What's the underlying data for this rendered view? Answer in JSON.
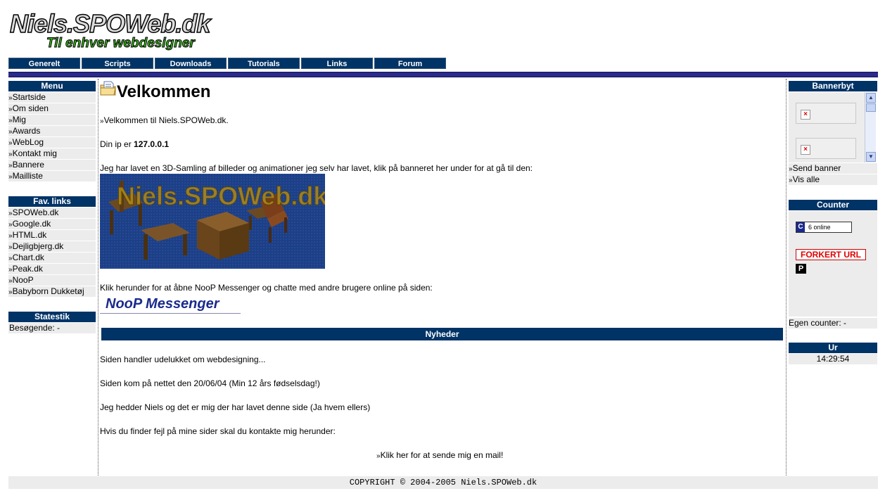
{
  "logo": {
    "title": "Niels.SPOWeb.dk",
    "tagline": "Til enhver webdesigner"
  },
  "nav": [
    "Generelt",
    "Scripts",
    "Downloads",
    "Tutorials",
    "Links",
    "Forum"
  ],
  "bullet": "»",
  "menu": {
    "title": "Menu",
    "items": [
      "Startside",
      "Om siden",
      "Mig",
      "Awards",
      "WebLog",
      "Kontakt mig",
      "Bannere",
      "Mailliste"
    ]
  },
  "favlinks": {
    "title": "Fav. links",
    "items": [
      "SPOWeb.dk",
      "Google.dk",
      "HTML.dk",
      "Dejligbjerg.dk",
      "Chart.dk",
      "Peak.dk",
      "NooP",
      "Babyborn Dukketøj"
    ]
  },
  "stats": {
    "title": "Statestik",
    "visitors_label": "Besøgende: -"
  },
  "main": {
    "heading": "Velkommen",
    "welcome": "Velkommen til Niels.SPOWeb.dk.",
    "ip_label": "Din ip er ",
    "ip_value": "127.0.0.1",
    "samling_text": "Jeg har lavet en 3D-Samling af billeder og animationer jeg selv har lavet, klik på banneret her under for at gå til den:",
    "banner_text": "Niels.SPOWeb.dk",
    "noop_text": "Klik herunder for at åbne NooP Messenger og chatte med andre brugere online på siden:",
    "noop_logo": "NooP Messenger"
  },
  "news": {
    "title": "Nyheder",
    "lines": [
      "Siden handler udelukket om webdesigning...",
      "Siden kom på nettet den 20/06/04 (Min 12 års fødselsdag!)",
      "Jeg hedder Niels og det er mig der har lavet denne side (Ja hvem ellers)",
      "Hvis du finder fejl på mine sider skal du kontakte mig herunder:"
    ],
    "mail_link": "Klik her for at sende mig en mail!"
  },
  "bannerbyt": {
    "title": "Bannerbyt",
    "links": [
      "Send banner",
      "Vis alle"
    ]
  },
  "counter": {
    "title": "Counter",
    "online_badge_letter": "C",
    "online_text": "6 online",
    "forkert_url": "FORKERT URL",
    "p_badge": "P",
    "egen_counter": "Egen counter: -"
  },
  "clock": {
    "title": "Ur",
    "time": "14:29:54"
  },
  "footer": "COPYRIGHT © 2004-2005 Niels.SPOWeb.dk",
  "colors": {
    "nav_bg": "#003366",
    "sidebar_item_bg": "#ececec",
    "divider": "#2b2b8c"
  }
}
